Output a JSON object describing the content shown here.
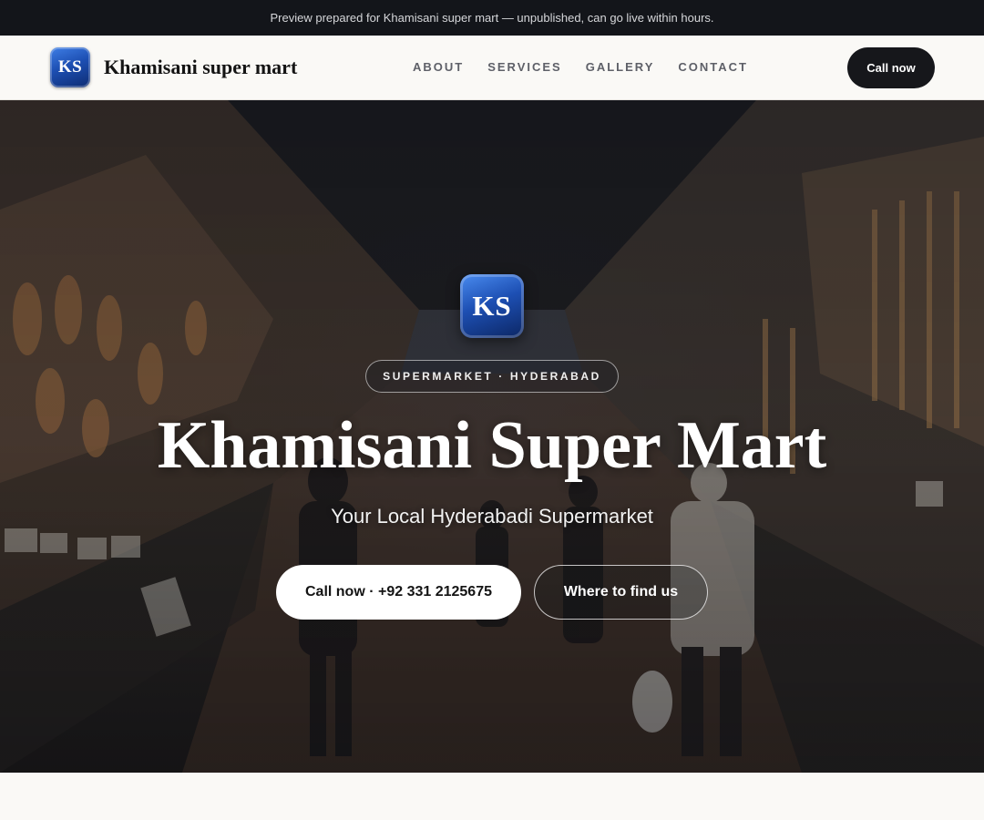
{
  "banner": {
    "text": "Preview prepared for Khamisani super mart — unpublished, can go live within hours."
  },
  "header": {
    "logo_initials": "KS",
    "brand_name": "Khamisani super mart",
    "nav": [
      "ABOUT",
      "SERVICES",
      "GALLERY",
      "CONTACT"
    ],
    "call_label": "Call now"
  },
  "hero": {
    "logo_initials": "KS",
    "tag": "SUPERMARKET · HYDERABAD",
    "title": "Khamisani Super Mart",
    "subtitle": "Your Local Hyderabadi Supermarket",
    "primary_button": "Call now · +92 331 2125675",
    "secondary_button": "Where to find us"
  },
  "colors": {
    "banner_bg": "#13151a",
    "header_bg": "#faf9f6",
    "accent_dark": "#16171b",
    "logo_blue": "#1d4fb3"
  }
}
